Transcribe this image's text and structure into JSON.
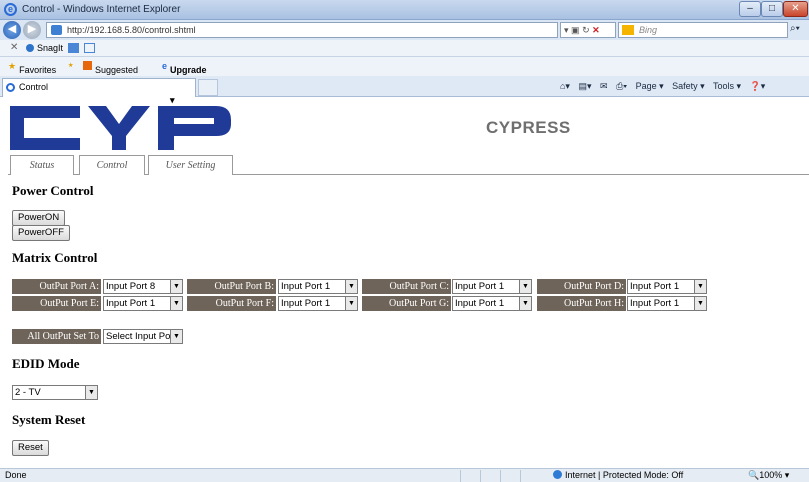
{
  "window": {
    "title": "Control - Windows Internet Explorer"
  },
  "address": {
    "url": "http://192.168.5.80/control.shtml"
  },
  "search": {
    "placeholder": "Bing"
  },
  "snagit": {
    "label": "SnagIt"
  },
  "favorites_bar": {
    "favorites": "Favorites",
    "suggested": "Suggested Sites ▾",
    "upgrade": "Upgrade Your Browser ▾"
  },
  "browser_tab": {
    "label": "Control"
  },
  "command_bar": {
    "page": "Page ▾",
    "safety": "Safety ▾",
    "tools": "Tools ▾",
    "help": "❓▾"
  },
  "brand": {
    "name": "CYPRESS"
  },
  "nav_tabs": [
    "Status",
    "Control",
    "User Setting"
  ],
  "power": {
    "heading": "Power Control",
    "on_label": "PowerON",
    "off_label": "PowerOFF"
  },
  "matrix": {
    "heading": "Matrix Control",
    "ports": [
      {
        "label": "OutPut Port A:",
        "value": "Input Port 8"
      },
      {
        "label": "OutPut Port B:",
        "value": "Input Port 1"
      },
      {
        "label": "OutPut Port C:",
        "value": "Input Port 1"
      },
      {
        "label": "OutPut Port D:",
        "value": "Input Port 1"
      },
      {
        "label": "OutPut Port E:",
        "value": "Input Port 1"
      },
      {
        "label": "OutPut Port F:",
        "value": "Input Port 1"
      },
      {
        "label": "OutPut Port G:",
        "value": "Input Port 1"
      },
      {
        "label": "OutPut Port H:",
        "value": "Input Port 1"
      }
    ],
    "all_label": "All OutPut Set To",
    "all_value": "Select Input Port"
  },
  "edid": {
    "heading": "EDID Mode",
    "value": "2 - TV"
  },
  "reset": {
    "heading": "System Reset",
    "button": "Reset"
  },
  "status_bar": {
    "status": "Done",
    "zone": "Internet | Protected Mode: Off",
    "zoom": "100%"
  },
  "colors": {
    "port_label_bg": "#6f6459",
    "logo_blue": "#1f3a97"
  }
}
